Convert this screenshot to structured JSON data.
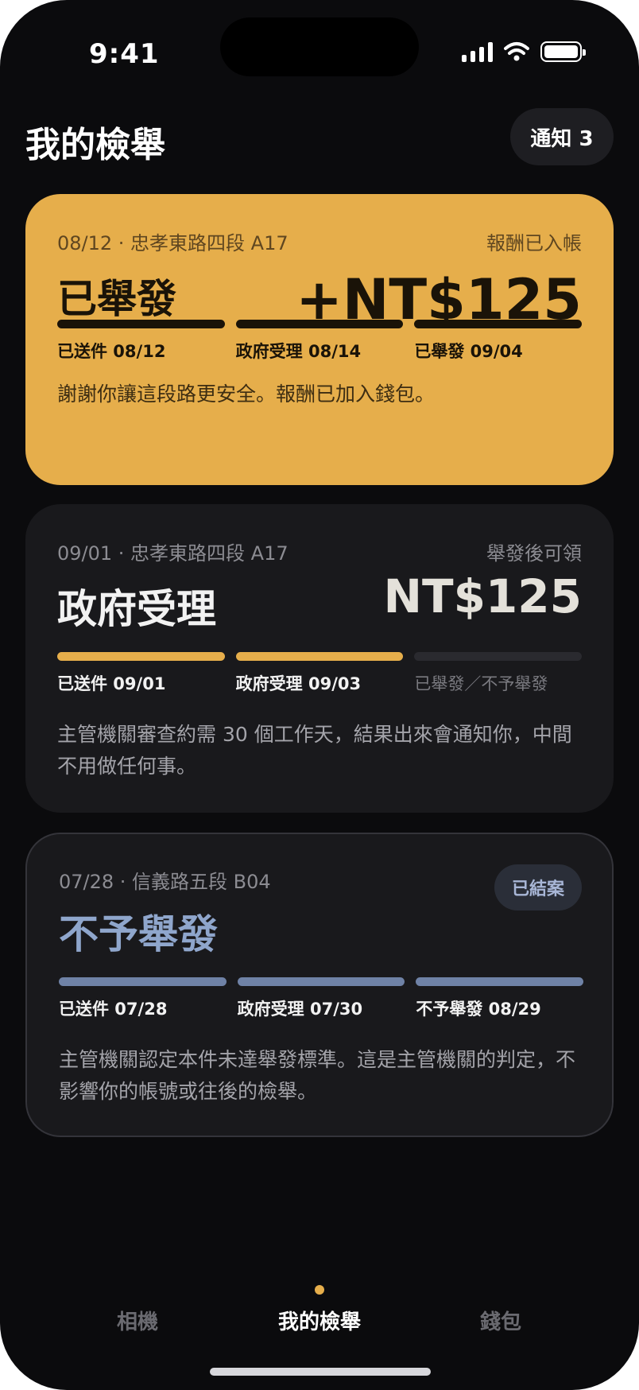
{
  "status_bar": {
    "time": "9:41"
  },
  "header": {
    "title": "我的檢舉",
    "notify_label": "通知 3"
  },
  "cards": [
    {
      "date_location": "08/12 · 忠孝東路四段 A17",
      "right_meta": "報酬已入帳",
      "status": "已舉發",
      "amount": "+NT$125",
      "steps": [
        "已送件 08/12",
        "政府受理 08/14",
        "已舉發 09/04"
      ],
      "progress_complete": [
        true,
        true,
        true
      ],
      "description": "謝謝你讓這段路更安全。報酬已加入錢包。",
      "colors": {
        "background": "#e6ae4b",
        "bar": "#1a1308"
      }
    },
    {
      "date_location": "09/01 · 忠孝東路四段 A17",
      "right_meta": "舉發後可領",
      "status": "政府受理",
      "amount": "NT$125",
      "steps": [
        "已送件 09/01",
        "政府受理 09/03",
        "已舉發／不予舉發"
      ],
      "progress_complete": [
        true,
        true,
        false
      ],
      "description": "主管機關審查約需 30 個工作天，結果出來會通知你，中間不用做任何事。",
      "colors": {
        "bar_done": "#e6ae4b",
        "bar_pending": "#2a2a2f"
      }
    },
    {
      "date_location": "07/28 · 信義路五段 B04",
      "badge": "已結案",
      "status": "不予舉發",
      "steps": [
        "已送件 07/28",
        "政府受理 07/30",
        "不予舉發 08/29"
      ],
      "progress_complete": [
        true,
        true,
        true
      ],
      "description": "主管機關認定本件未達舉發標準。這是主管機關的判定，不影響你的帳號或往後的檢舉。",
      "colors": {
        "status_text": "#8fa6cc",
        "bar": "#6f82a6"
      }
    }
  ],
  "bottom_nav": {
    "items": [
      "相機",
      "我的檢舉",
      "錢包"
    ],
    "active_index": 1
  },
  "icons": [
    "signal-icon",
    "wifi-icon",
    "battery-icon"
  ]
}
